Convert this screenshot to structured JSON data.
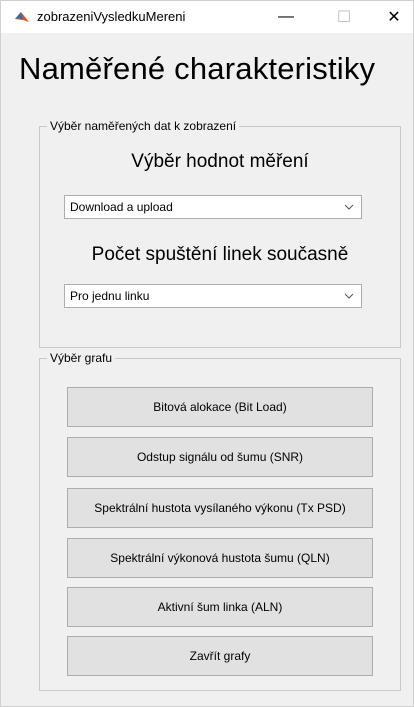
{
  "window": {
    "title": "zobrazeniVysledkuMereni",
    "minimize_glyph": "—",
    "maximize_glyph": "☐",
    "close_glyph": "✕"
  },
  "page_title": "Naměřené charakteristiky",
  "data_panel": {
    "legend": "Výběr naměřených dat k zobrazení",
    "measurement_label": "Výběr hodnot měření",
    "measurement_select_value": "Download a upload",
    "lines_label": "Počet spuštění linek současně",
    "lines_select_value": "Pro jednu linku"
  },
  "graph_panel": {
    "legend": "Výběr grafu",
    "buttons": [
      "Bitová alokace (Bit Load)",
      "Odstup signálu od šumu (SNR)",
      "Spektrální hustota vysílaného výkonu (Tx PSD)",
      "Spektrální výkonová hustota šumu (QLN)",
      "Aktivní šum linka (ALN)",
      "Zavřít grafy"
    ]
  },
  "icons": {
    "app": "matlab-icon",
    "dropdown": "chevron-down-icon"
  }
}
